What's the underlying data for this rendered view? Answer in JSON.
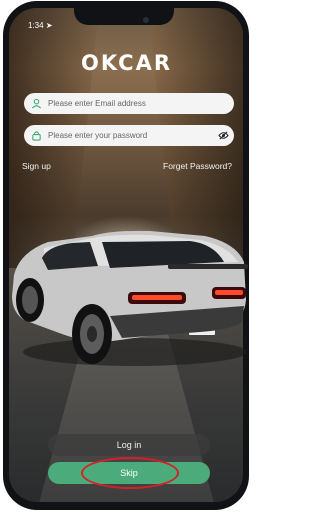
{
  "status": {
    "time": "1:34",
    "indicators": ""
  },
  "brand": {
    "logo": "OKCAR"
  },
  "form": {
    "email_placeholder": "Please enter Email address",
    "password_placeholder": "Please enter your password"
  },
  "links": {
    "signup": "Sign up",
    "forgot": "Forget Password?"
  },
  "buttons": {
    "login": "Log in",
    "skip": "Skip"
  },
  "colors": {
    "skip_button": "#4cab7a",
    "icon_accent": "#45a97a",
    "highlight_ring": "#d3202a"
  },
  "icons": [
    "user-icon",
    "lock-icon",
    "eye-off-icon",
    "location-arrow-icon"
  ]
}
